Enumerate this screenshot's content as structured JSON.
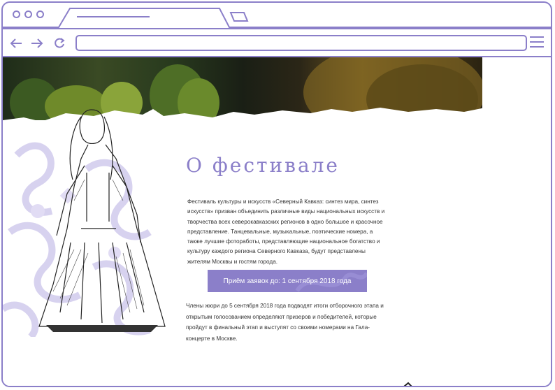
{
  "hero": {
    "image_alt": ""
  },
  "about": {
    "heading": "О фестивале",
    "paragraph": "Фестиваль культуры и искусств «Северный Кавказ: синтез мира, синтез искусств» призван объединить различные виды национальных искусств и творчества всех северокавказских регионов в одно большое и красочное представление. Танцевальные, музыкальные, поэтические номера, а также лучшие фотоработы, представляющие национальное богатство и культуру каждого региона Северного Кавказа, будут представлены жителям Москвы и гостям города.",
    "cta_label": "Приём заявок до: 1 сентября 2018 года",
    "paragraph2": "Члены жюри до 5 сентября 2018 года подводят итоги отборочного этапа и открытым голосованием определяют призеров и победителей, которые пройдут в финальный этап и выступят со своими номерами на Гала-концерте в Москве."
  },
  "colors": {
    "accent": "#8b7fc9",
    "text": "#333333"
  },
  "icons": {
    "back": "arrow-left-icon",
    "forward": "arrow-right-icon",
    "reload": "reload-icon",
    "menu": "hamburger-icon"
  }
}
